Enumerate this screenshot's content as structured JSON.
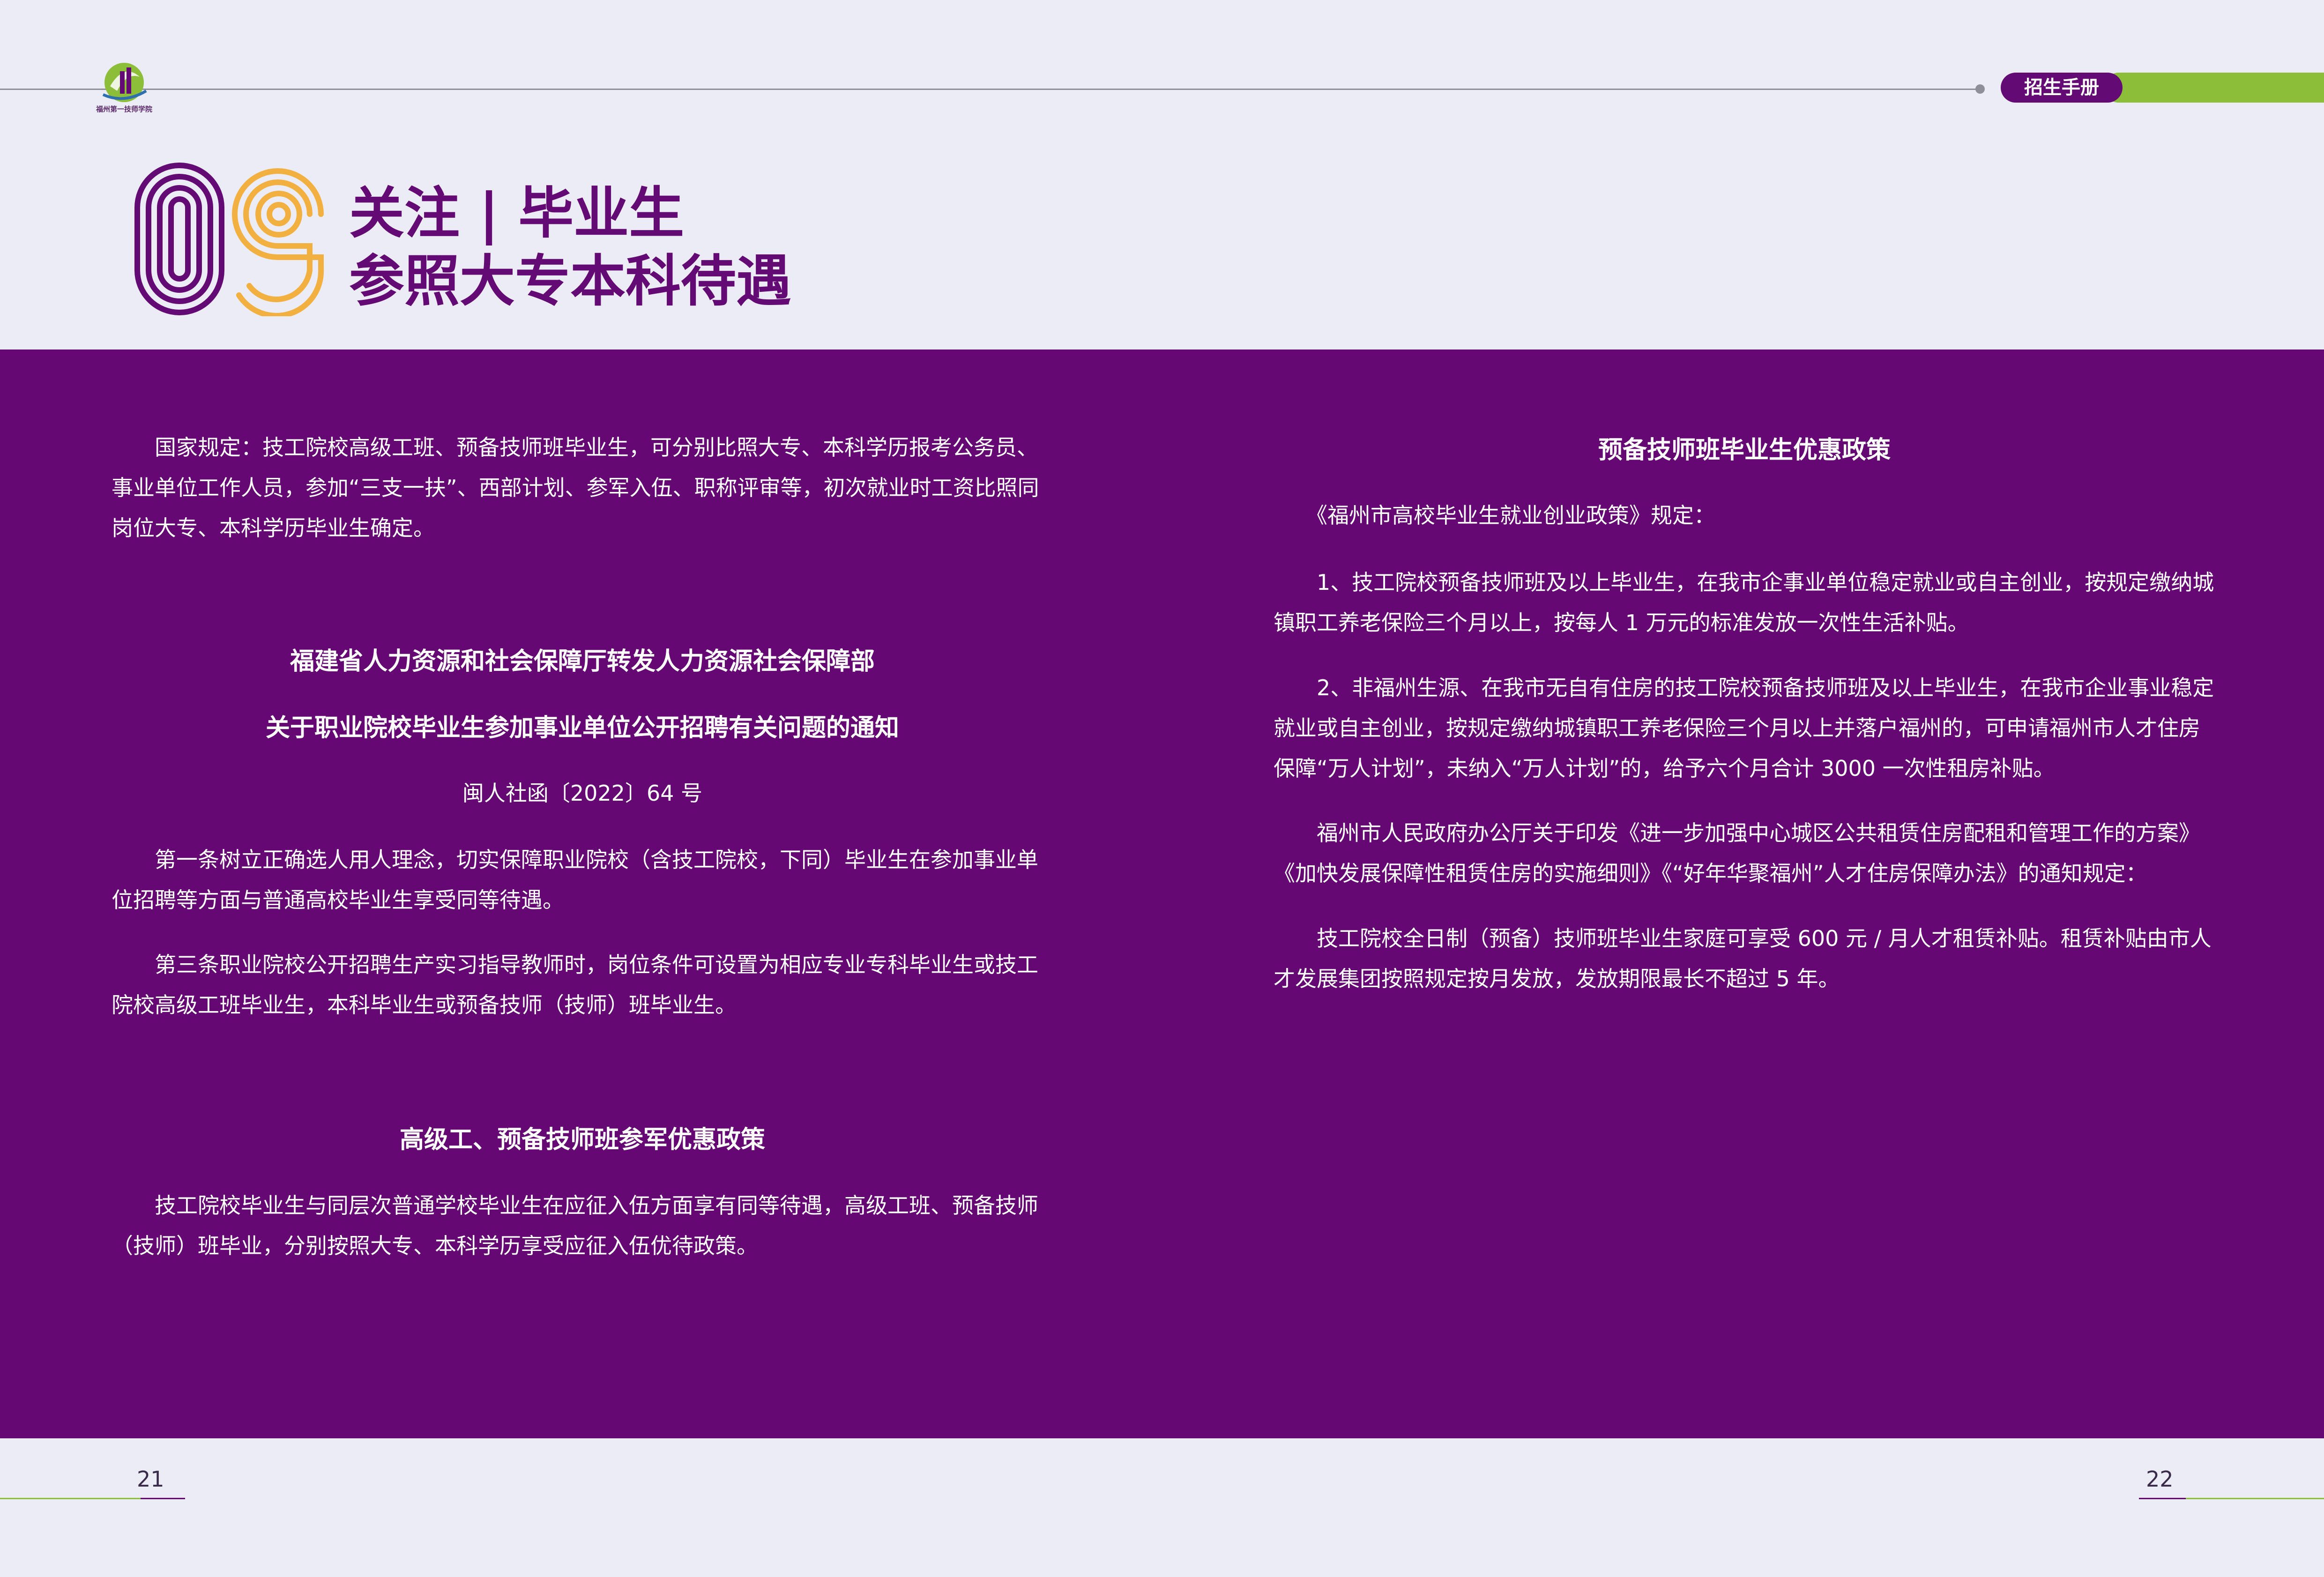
{
  "header": {
    "logo_caption": "福州第一技师学院",
    "tag": "招生手册"
  },
  "section": {
    "number": "09",
    "title_line1": "关注 | 毕业生",
    "title_line2": "参照大专本科待遇"
  },
  "left": {
    "intro": "　　国家规定：技工院校高级工班、预备技师班毕业生，可分别比照大专、本科学历报考公务员、事业单位工作人员，参加“三支一扶”、西部计划、参军入伍、职称评审等，初次就业时工资比照同岗位大专、本科学历毕业生确定。",
    "notice_title1": "福建省人力资源和社会保障厅转发人力资源社会保障部",
    "notice_title2": "关于职业院校毕业生参加事业单位公开招聘有关问题的通知",
    "doc_no": "闽人社函〔2022〕64 号",
    "art1": "　　第一条树立正确选人用人理念，切实保障职业院校（含技工院校，下同）毕业生在参加事业单位招聘等方面与普通高校毕业生享受同等待遇。",
    "art3": "　　第三条职业院校公开招聘生产实习指导教师时，岗位条件可设置为相应专业专科毕业生或技工院校高级工班毕业生，本科毕业生或预备技师（技师）班毕业生。",
    "army_title": "高级工、预备技师班参军优惠政策",
    "army_text": "　　技工院校毕业生与同层次普通学校毕业生在应征入伍方面享有同等待遇，高级工班、预备技师（技师）班毕业，分别按照大专、本科学历享受应征入伍优待政策。"
  },
  "right": {
    "title": "预备技师班毕业生优惠政策",
    "lead": "　　《福州市高校毕业生就业创业政策》规定：",
    "item1": "　　1、技工院校预备技师班及以上毕业生，在我市企事业单位稳定就业或自主创业，按规定缴纳城镇职工养老保险三个月以上，按每人 1 万元的标准发放一次性生活补贴。",
    "item2": "　　2、非福州生源、在我市无自有住房的技工院校预备技师班及以上毕业生，在我市企业事业稳定就业或自主创业，按规定缴纳城镇职工养老保险三个月以上并落户福州的，可申请福州市人才住房保障“万人计划”，未纳入“万人计划”的，给予六个月合计 3000 一次性租房补贴。",
    "notice": "　　福州市人民政府办公厅关于印发《进一步加强中心城区公共租赁住房配租和管理工作的方案》《加快发展保障性租赁住房的实施细则》《“好年华聚福州”人才住房保障办法》的通知规定：",
    "subsidy": "　　技工院校全日制（预备）技师班毕业生家庭可享受 600 元 / 月人才租赁补贴。租赁补贴由市人才发展集团按照规定按月发放，发放期限最长不超过 5 年。"
  },
  "footer": {
    "page_left": "21",
    "page_right": "22"
  },
  "colors": {
    "purple": "#650874",
    "green": "#8cbe3a",
    "orange": "#f2b040",
    "background": "#ececf6"
  }
}
